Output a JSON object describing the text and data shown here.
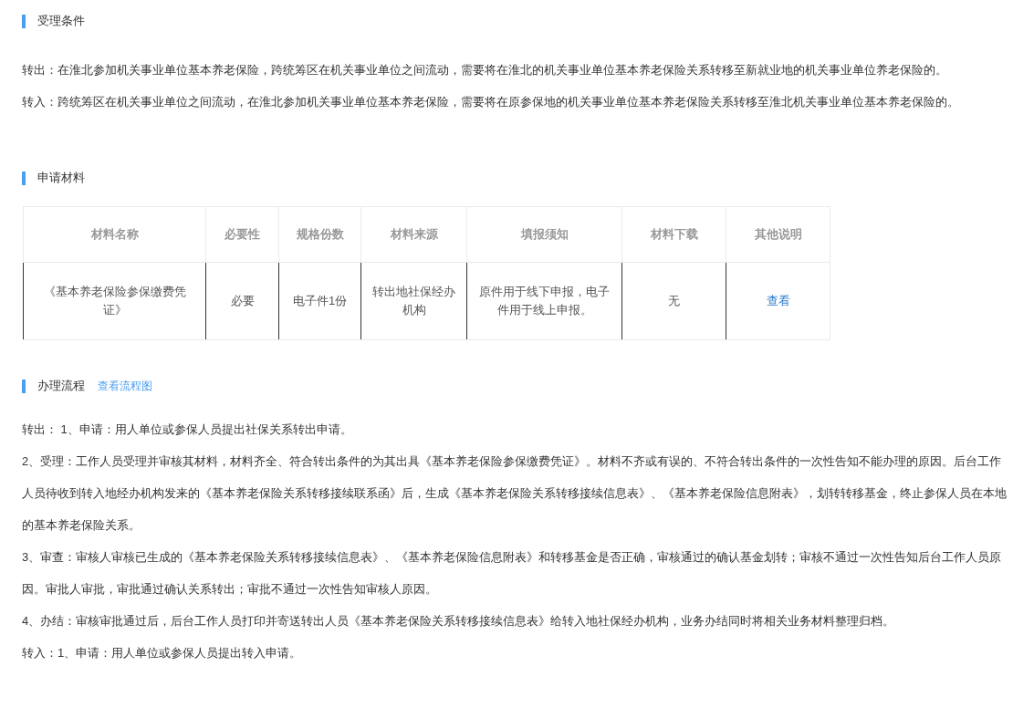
{
  "sections": [
    {
      "kind": "text",
      "title": "受理条件",
      "paragraphs": [
        "转出：在淮北参加机关事业单位基本养老保险，跨统筹区在机关事业单位之间流动，需要将在淮北的机关事业单位基本养老保险关系转移至新就业地的机关事业单位养老保险的。",
        "转入：跨统筹区在机关事业单位之间流动，在淮北参加机关事业单位基本养老保险，需要将在原参保地的机关事业单位基本养老保险关系转移至淮北机关事业单位基本养老保险的。"
      ]
    },
    {
      "kind": "table",
      "title": "申请材料",
      "columns": [
        "材料名称",
        "必要性",
        "规格份数",
        "材料来源",
        "填报须知",
        "材料下载",
        "其他说明"
      ],
      "rows": [
        {
          "cells": [
            "《基本养老保险参保缴费凭证》",
            "必要",
            "电子件1份",
            "转出地社保经办机构",
            "原件用于线下申报，电子件用于线上申报。",
            "无"
          ],
          "link": "查看"
        }
      ]
    },
    {
      "kind": "text",
      "title": "办理流程",
      "link": "查看流程图",
      "paragraphs": [
        "转出： 1、申请：用人单位或参保人员提出社保关系转出申请。",
        "2、受理：工作人员受理并审核其材料，材料齐全、符合转出条件的为其出具《基本养老保险参保缴费凭证》。材料不齐或有误的、不符合转出条件的一次性告知不能办理的原因。后台工作人员待收到转入地经办机构发来的《基本养老保险关系转移接续联系函》后，生成《基本养老保险关系转移接续信息表》、《基本养老保险信息附表》，划转转移基金，终止参保人员在本地的基本养老保险关系。",
        "3、审查：审核人审核已生成的《基本养老保险关系转移接续信息表》、《基本养老保险信息附表》和转移基金是否正确，审核通过的确认基金划转；审核不通过一次性告知后台工作人员原因。审批人审批，审批通过确认关系转出；审批不通过一次性告知审核人原因。",
        "4、办结：审核审批通过后，后台工作人员打印并寄送转出人员《基本养老保险关系转移接续信息表》给转入地社保经办机构，业务办结同时将相关业务材料整理归档。",
        "转入：1、申请：用人单位或参保人员提出转入申请。"
      ]
    }
  ]
}
